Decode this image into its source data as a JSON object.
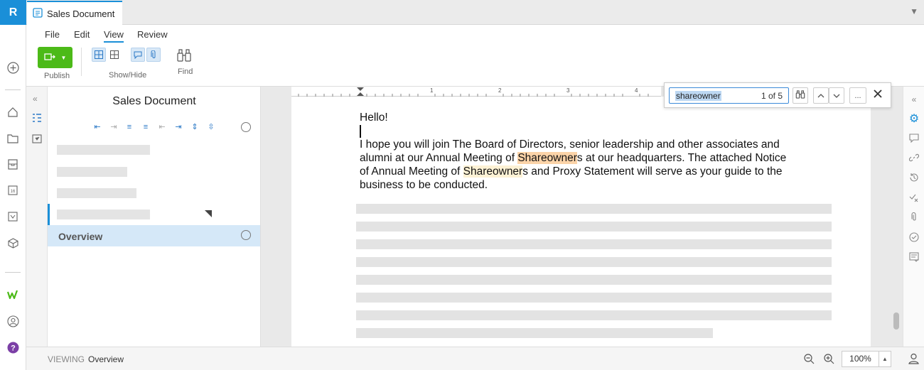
{
  "app": {
    "logo_letter": "R",
    "brand_color": "#1a8fd8",
    "accent_green": "#4cba18"
  },
  "tab": {
    "title": "Sales Document"
  },
  "menu": {
    "file": "File",
    "edit": "Edit",
    "view": "View",
    "review": "Review",
    "active": "View"
  },
  "ribbon": {
    "publish_label": "Publish",
    "showhide_label": "Show/Hide",
    "find_label": "Find"
  },
  "outline": {
    "title": "Sales Document",
    "active_item": "Overview"
  },
  "ruler": {
    "marks": [
      "1",
      "2",
      "3",
      "4"
    ]
  },
  "document": {
    "greeting": "Hello!",
    "p1_a": "I hope you will join The Board of Directors, senior leadership and other associates and",
    "p2_a": "alumni at our Annual Meeting of ",
    "p2_hl": "Shareowner",
    "p2_b": "s at our headquarters. The attached Notice",
    "p3_a": "of Annual Meeting of ",
    "p3_hl": "Shareowner",
    "p3_b": "s and Proxy Statement will serve as your guide to the",
    "p4": "business to be conducted."
  },
  "find": {
    "query": "shareowner",
    "count": "1 of 5",
    "more": "..."
  },
  "status": {
    "mode_label": "VIEWING",
    "section": "Overview",
    "zoom": "100%"
  }
}
